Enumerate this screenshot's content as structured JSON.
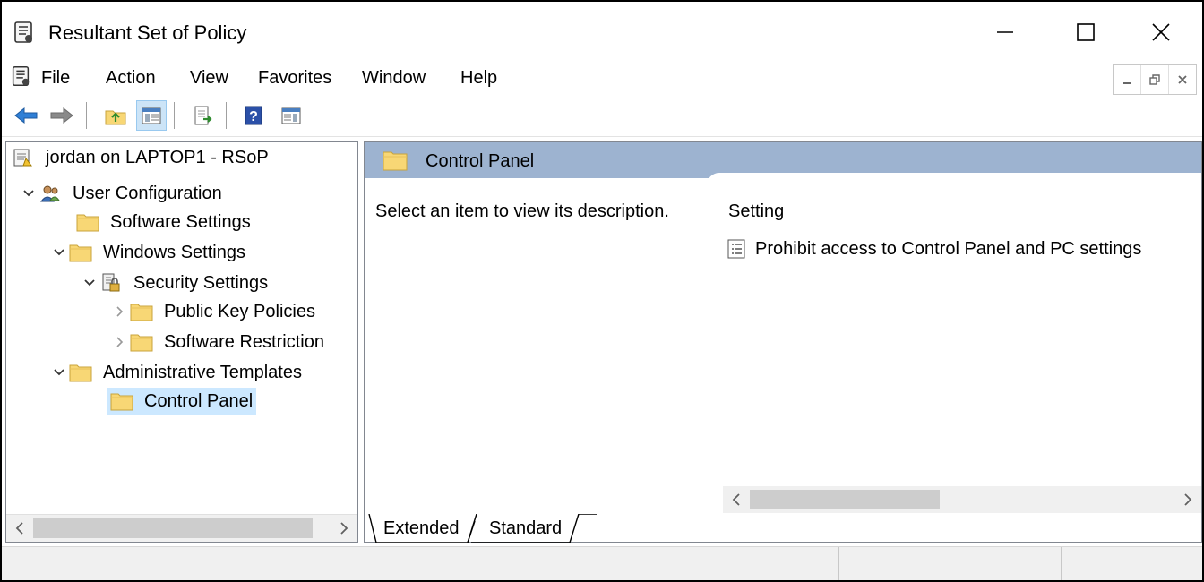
{
  "window": {
    "title": "Resultant Set of Policy"
  },
  "menu": {
    "items": [
      "File",
      "Action",
      "View",
      "Favorites",
      "Window",
      "Help"
    ]
  },
  "tree": {
    "items": [
      {
        "label": "jordan on LAPTOP1 - RSoP",
        "icon": "rsop-icon",
        "expander": "none"
      },
      {
        "label": "User Configuration",
        "icon": "users-icon",
        "expander": "expanded"
      },
      {
        "label": "Software Settings",
        "icon": "folder-icon",
        "expander": "none"
      },
      {
        "label": "Windows Settings",
        "icon": "folder-icon",
        "expander": "expanded"
      },
      {
        "label": "Security Settings",
        "icon": "security-settings-icon",
        "expander": "expanded"
      },
      {
        "label": "Public Key Policies",
        "icon": "folder-icon",
        "expander": "collapsed"
      },
      {
        "label": "Software Restriction",
        "icon": "folder-icon",
        "expander": "collapsed"
      },
      {
        "label": "Administrative Templates",
        "icon": "folder-icon",
        "expander": "expanded"
      },
      {
        "label": "Control Panel",
        "icon": "folder-icon",
        "expander": "none",
        "selected": true
      }
    ]
  },
  "details": {
    "header_title": "Control Panel",
    "description": "Select an item to view its description.",
    "column_header": "Setting",
    "settings": [
      "Prohibit access to Control Panel and PC settings"
    ]
  },
  "tabs": [
    {
      "label": "Extended",
      "active": true
    },
    {
      "label": "Standard",
      "active": false
    }
  ],
  "colors": {
    "header_bg": "#9db3d0",
    "selection_bg": "#cce8ff",
    "folder": "#f8d775"
  }
}
